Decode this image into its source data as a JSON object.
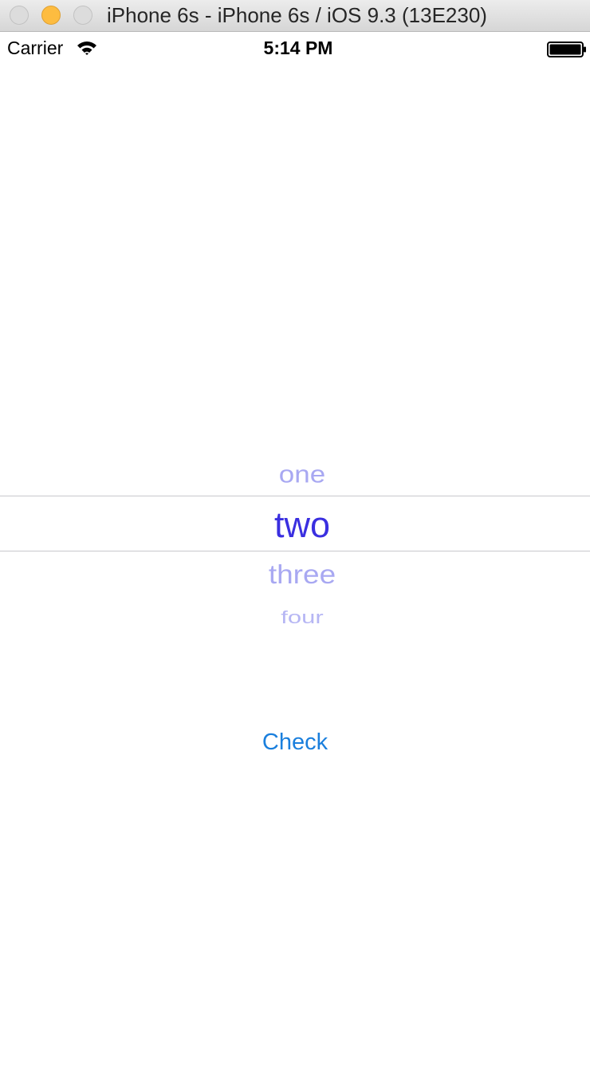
{
  "window": {
    "title": "iPhone 6s - iPhone 6s / iOS 9.3 (13E230)"
  },
  "status_bar": {
    "carrier": "Carrier",
    "time": "5:14 PM",
    "wifi_icon": "wifi-icon",
    "battery_icon": "battery-full-icon"
  },
  "picker": {
    "rows": [
      "one",
      "two",
      "three",
      "four"
    ],
    "selected": "two",
    "colors": {
      "selected": "#3a2fe0",
      "unselected": "#a8a8f2",
      "separator": "#c8c8cc"
    }
  },
  "check_button": {
    "label": "Check",
    "color": "#1a7fdd"
  }
}
